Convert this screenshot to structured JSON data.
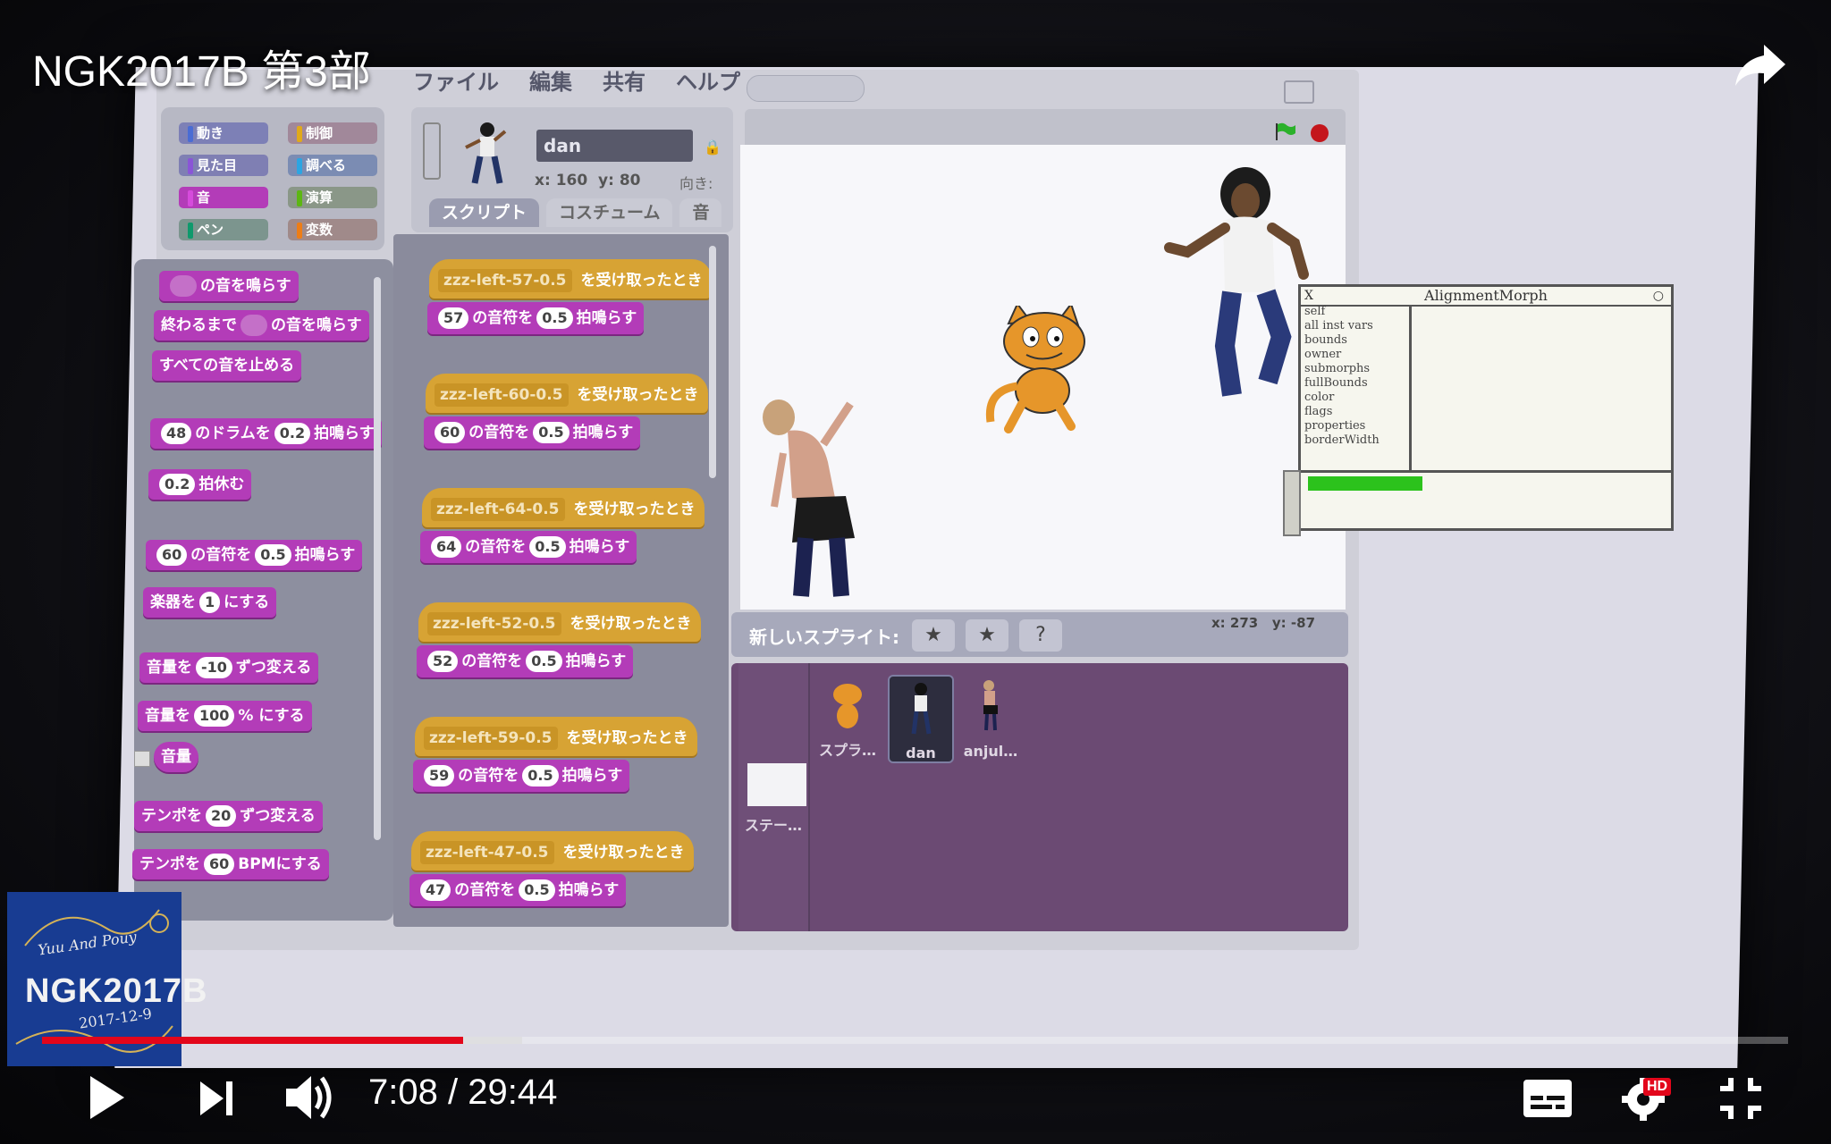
{
  "video": {
    "title": "NGK2017B 第3部",
    "current_time": "7:08",
    "separator": "/",
    "duration": "29:44",
    "progress_fraction": 0.241,
    "buffered_fraction": 0.275,
    "hd_badge": "HD",
    "accent_color": "#e3061b"
  },
  "logo": {
    "line1": "Yuu And Pouy",
    "line2": "NGK2017B",
    "line3": "2017-12-9"
  },
  "scratch": {
    "menu": [
      "ファイル",
      "編集",
      "共有",
      "ヘルプ"
    ],
    "categories": [
      {
        "label": "動き",
        "color": "#4a6cd4"
      },
      {
        "label": "制御",
        "color": "#e1a91a"
      },
      {
        "label": "見た目",
        "color": "#8a55d7"
      },
      {
        "label": "調べる",
        "color": "#2ca5e2"
      },
      {
        "label": "音",
        "color": "#bb42c3"
      },
      {
        "label": "演算",
        "color": "#5cb712"
      },
      {
        "label": "ペン",
        "color": "#0e9a6c"
      },
      {
        "label": "変数",
        "color": "#ee7d16"
      }
    ],
    "palette": {
      "b1": "の音を鳴らす",
      "b2a": "終わるまで",
      "b2b": "の音を鳴らす",
      "b3": "すべての音を止める",
      "b4n1": "48",
      "b4a": "のドラムを",
      "b4n2": "0.2",
      "b4b": "拍鳴らす",
      "b5n": "0.2",
      "b5": "拍休む",
      "b6n1": "60",
      "b6a": "の音符を",
      "b6n2": "0.5",
      "b6b": "拍鳴らす",
      "b7a": "楽器を",
      "b7n": "1",
      "b7b": "にする",
      "b8a": "音量を",
      "b8n": "-10",
      "b8b": "ずつ変える",
      "b9a": "音量を",
      "b9n": "100",
      "b9b": "% にする",
      "b10": "音量",
      "b11a": "テンポを",
      "b11n": "20",
      "b11b": "ずつ変える",
      "b12a": "テンポを",
      "b12n": "60",
      "b12b": "BPMにする"
    },
    "sprite": {
      "name": "dan",
      "x_label": "x:",
      "x": "160",
      "y_label": "y:",
      "y": "80",
      "direction_label": "向き:"
    },
    "tabs": [
      "スクリプト",
      "コスチューム",
      "音"
    ],
    "scripts": [
      {
        "msg": "zzz-left-57-0.5",
        "hat_suffix": "を受け取ったとき",
        "note": "57",
        "mid": "の音符を",
        "beats": "0.5",
        "end": "拍鳴らす"
      },
      {
        "msg": "zzz-left-60-0.5",
        "hat_suffix": "を受け取ったとき",
        "note": "60",
        "mid": "の音符を",
        "beats": "0.5",
        "end": "拍鳴らす"
      },
      {
        "msg": "zzz-left-64-0.5",
        "hat_suffix": "を受け取ったとき",
        "note": "64",
        "mid": "の音符を",
        "beats": "0.5",
        "end": "拍鳴らす"
      },
      {
        "msg": "zzz-left-52-0.5",
        "hat_suffix": "を受け取ったとき",
        "note": "52",
        "mid": "の音符を",
        "beats": "0.5",
        "end": "拍鳴らす"
      },
      {
        "msg": "zzz-left-59-0.5",
        "hat_suffix": "を受け取ったとき",
        "note": "59",
        "mid": "の音符を",
        "beats": "0.5",
        "end": "拍鳴らす"
      },
      {
        "msg": "zzz-left-47-0.5",
        "hat_suffix": "を受け取ったとき",
        "note": "47",
        "mid": "の音符を",
        "beats": "0.5",
        "end": "拍鳴らす"
      }
    ],
    "new_sprite_label": "新しいスプライト:",
    "mouse": {
      "x_label": "x:",
      "x": "273",
      "y_label": "y:",
      "y": "-87"
    },
    "sprites": [
      "スプラ…",
      "dan",
      "anjul…"
    ],
    "stage_label": "ステー…"
  },
  "morph": {
    "title": "AlignmentMorph",
    "close": "X",
    "fields": [
      "self",
      "all inst vars",
      "bounds",
      "owner",
      "submorphs",
      "fullBounds",
      "color",
      "flags",
      "properties",
      "borderWidth"
    ]
  }
}
